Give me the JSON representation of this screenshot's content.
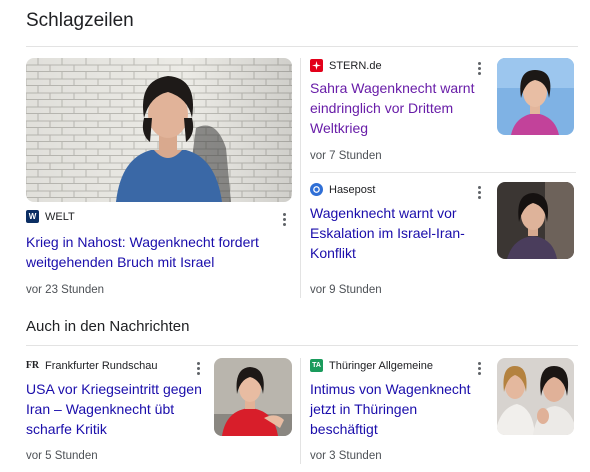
{
  "section_title": "Schlagzeilen",
  "subsection_title": "Auch in den Nachrichten",
  "colors": {
    "link": "#1a0dab",
    "visited": "#681da8",
    "meta": "#4d5156",
    "divider": "#e3e3e3"
  },
  "top": {
    "main": {
      "source": "WELT",
      "source_icon": "welt-logo-icon",
      "headline": "Krieg in Nahost: Wagenknecht fordert weitgehenden Bruch mit Israel",
      "time": "vor 23 Stunden"
    },
    "right": [
      {
        "source": "STERN.de",
        "source_icon": "stern-logo-icon",
        "headline": "Sahra Wagenknecht warnt eindringlich vor Drittem Weltkrieg",
        "time": "vor 7 Stunden"
      },
      {
        "source": "Hasepost",
        "source_icon": "hasepost-logo-icon",
        "headline": "Wagenknecht warnt vor Eskalation im Israel-Iran-Konflikt",
        "time": "vor 9 Stunden"
      }
    ]
  },
  "more": [
    {
      "source": "Frankfurter Rundschau",
      "source_icon": "fr-logo-icon",
      "headline": "USA vor Kriegseintritt gegen Iran – Wagenknecht übt scharfe Kritik",
      "time": "vor 5 Stunden"
    },
    {
      "source": "Thüringer Allgemeine",
      "source_icon": "ta-logo-icon",
      "headline": "Intimus von Wagenknecht jetzt in Thüringen beschäftigt",
      "time": "vor 3 Stunden"
    }
  ]
}
